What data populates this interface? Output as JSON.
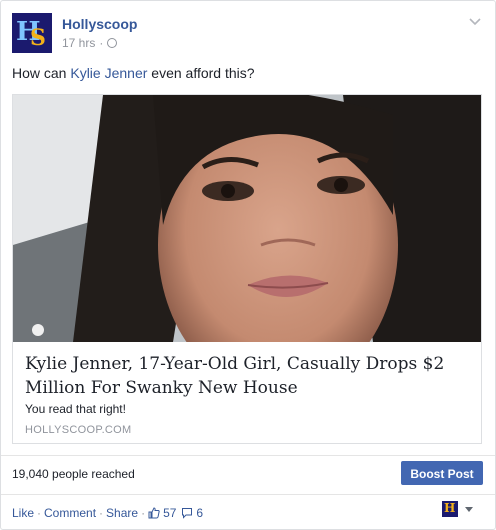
{
  "post": {
    "page_name": "Hollyscoop",
    "time": "17 hrs",
    "text_before": "How can ",
    "text_link": "Kylie Jenner",
    "text_after": " even afford this?"
  },
  "attachment": {
    "title": "Kylie Jenner, 17-Year-Old Girl, Casually Drops $2 Million For Swanky New House",
    "description": "You read that right!",
    "domain": "HOLLYSCOOP.COM"
  },
  "insights": {
    "reach": "19,040 people reached",
    "boost_label": "Boost Post"
  },
  "actions": {
    "like": "Like",
    "comment": "Comment",
    "share": "Share",
    "likes_count": "57",
    "comments_count": "6"
  },
  "icons": {
    "avatar": "hollyscoop-logo",
    "privacy": "globe-icon",
    "menu": "chevron-down-icon",
    "like_count": "thumbs-up-icon",
    "comment_count": "comment-bubble-icon"
  },
  "colors": {
    "link": "#365899",
    "button": "#4267b2",
    "muted": "#90949c"
  }
}
